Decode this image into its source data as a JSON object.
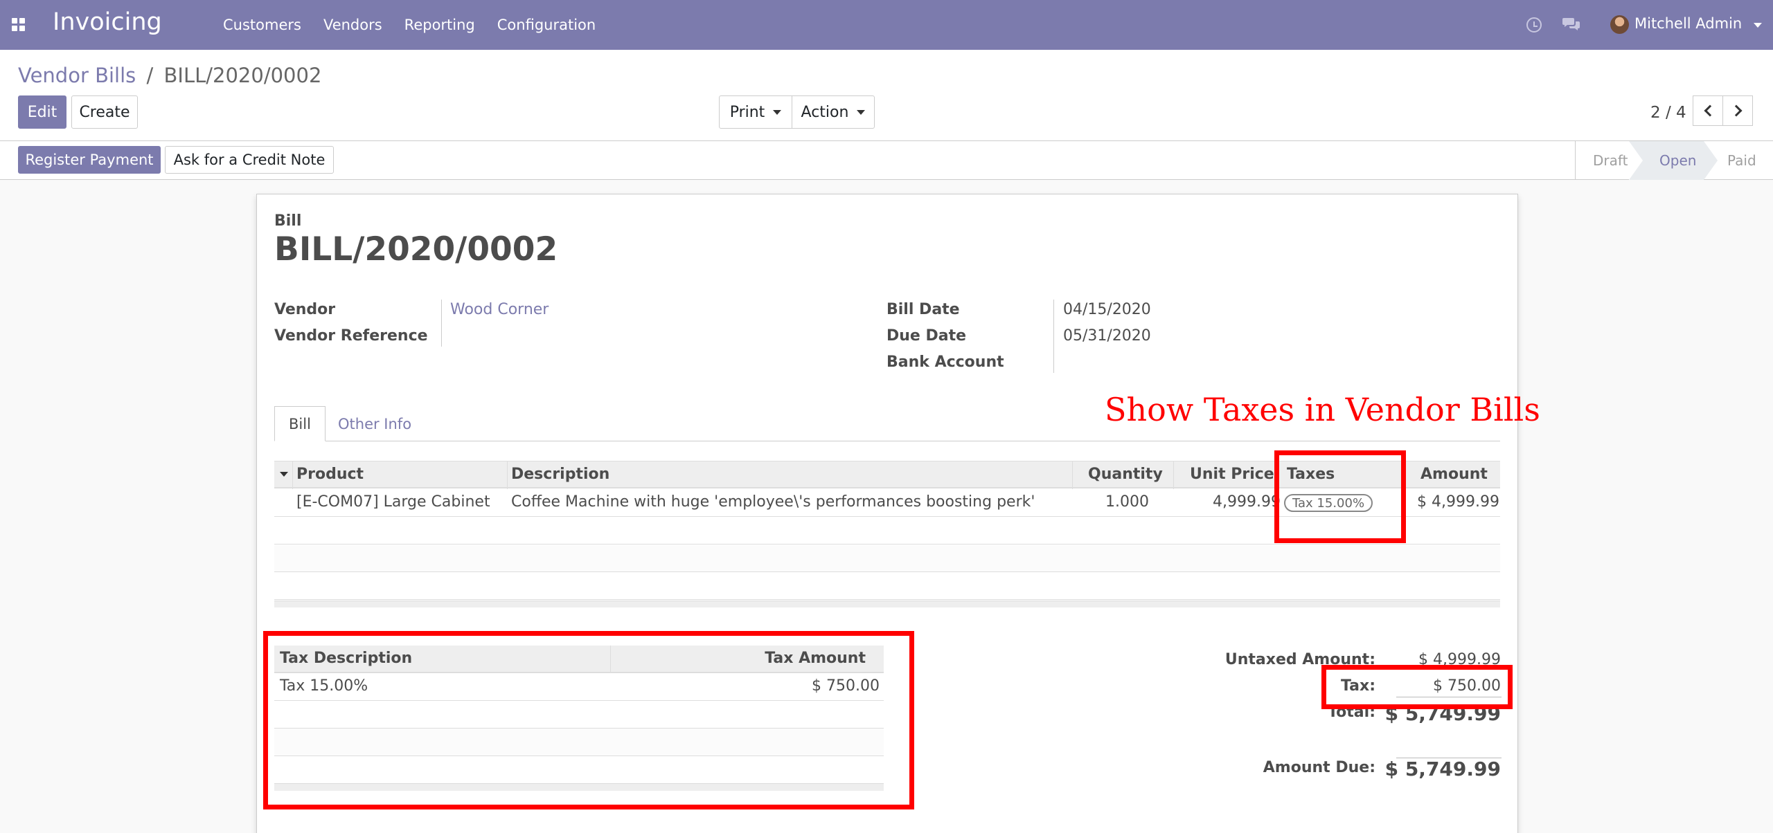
{
  "navbar": {
    "app_name": "Invoicing",
    "menu": [
      "Customers",
      "Vendors",
      "Reporting",
      "Configuration"
    ],
    "user": "Mitchell Admin",
    "bg_color": "#7c7bad"
  },
  "breadcrumb": {
    "parent": "Vendor Bills",
    "separator": "/",
    "current": "BILL/2020/0002"
  },
  "buttons": {
    "edit": "Edit",
    "create": "Create",
    "print": "Print",
    "action": "Action",
    "register_payment": "Register Payment",
    "credit_note": "Ask for a Credit Note"
  },
  "pager": {
    "value": "2 / 4"
  },
  "status": {
    "stages": [
      "Draft",
      "Open",
      "Paid"
    ],
    "active": "Open"
  },
  "bill": {
    "label": "Bill",
    "number": "BILL/2020/0002",
    "vendor_label": "Vendor",
    "vendor": "Wood Corner",
    "vendor_ref_label": "Vendor Reference",
    "vendor_ref": "",
    "bill_date_label": "Bill Date",
    "bill_date": "04/15/2020",
    "due_date_label": "Due Date",
    "due_date": "05/31/2020",
    "bank_account_label": "Bank Account",
    "bank_account": ""
  },
  "tabs": [
    "Bill",
    "Other Info"
  ],
  "lines": {
    "headers": [
      "Product",
      "Description",
      "Quantity",
      "Unit Price",
      "Taxes",
      "Amount"
    ],
    "rows": [
      {
        "product": "[E-COM07] Large Cabinet",
        "description": "Coffee Machine with huge 'employee\\'s performances boosting perk'",
        "quantity": "1.000",
        "unit_price": "4,999.99",
        "taxes": "Tax 15.00%",
        "amount": "$ 4,999.99"
      }
    ]
  },
  "tax_table": {
    "headers": [
      "Tax Description",
      "Tax Amount"
    ],
    "rows": [
      {
        "description": "Tax 15.00%",
        "amount": "$ 750.00"
      }
    ]
  },
  "totals": {
    "untaxed_label": "Untaxed Amount:",
    "untaxed": "$ 4,999.99",
    "tax_label": "Tax:",
    "tax": "$ 750.00",
    "total_label": "Total:",
    "total": "$ 5,749.99",
    "amount_due_label": "Amount Due:",
    "amount_due": "$ 5,749.99"
  },
  "annotation": {
    "text": "Show Taxes in Vendor Bills",
    "color": "#ff0000"
  }
}
